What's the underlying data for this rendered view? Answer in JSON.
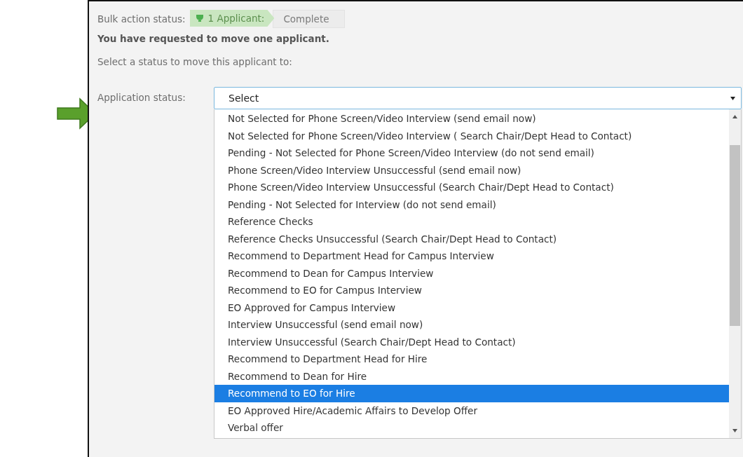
{
  "bulk_action": {
    "label": "Bulk action status:",
    "steps": [
      {
        "label": "1 Applicant:",
        "kind": "done"
      },
      {
        "label": "Complete",
        "kind": "pending"
      }
    ]
  },
  "message": "You have requested to move one applicant.",
  "instruction": "Select a status to move this applicant to:",
  "application_status": {
    "label": "Application status:",
    "value": "Select",
    "expanded": true,
    "options": [
      {
        "label": "Not Selected for Phone Screen/Video Interview (send email now)",
        "selected": false
      },
      {
        "label": "Not Selected for Phone Screen/Video Interview ( Search Chair/Dept Head to Contact)",
        "selected": false
      },
      {
        "label": "Pending - Not Selected for Phone Screen/Video Interview (do not send email)",
        "selected": false
      },
      {
        "label": "Phone Screen/Video Interview Unsuccessful (send email now)",
        "selected": false
      },
      {
        "label": "Phone Screen/Video Interview Unsuccessful (Search Chair/Dept Head to Contact)",
        "selected": false
      },
      {
        "label": "Pending - Not Selected for Interview (do not send email)",
        "selected": false
      },
      {
        "label": "Reference Checks",
        "selected": false
      },
      {
        "label": "Reference Checks Unsuccessful (Search Chair/Dept Head to Contact)",
        "selected": false
      },
      {
        "label": "Recommend to Department Head for Campus Interview",
        "selected": false
      },
      {
        "label": "Recommend to Dean for Campus Interview",
        "selected": false
      },
      {
        "label": "Recommend to EO for Campus Interview",
        "selected": false
      },
      {
        "label": "EO Approved for Campus Interview",
        "selected": false
      },
      {
        "label": "Interview Unsuccessful (send email now)",
        "selected": false
      },
      {
        "label": "Interview Unsuccessful (Search Chair/Dept Head to Contact)",
        "selected": false
      },
      {
        "label": "Recommend to Department Head for Hire",
        "selected": false
      },
      {
        "label": "Recommend to Dean for Hire",
        "selected": false
      },
      {
        "label": "Recommend to EO for Hire",
        "selected": true
      },
      {
        "label": "EO Approved Hire/Academic Affairs to Develop Offer",
        "selected": false
      },
      {
        "label": "Verbal offer",
        "selected": false
      }
    ]
  }
}
